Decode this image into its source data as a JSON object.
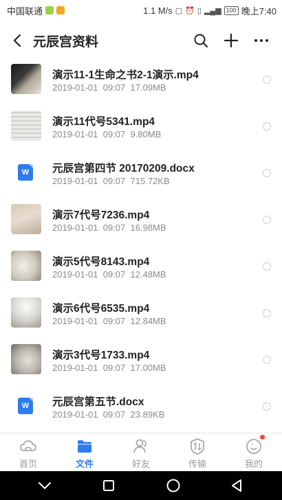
{
  "status_bar": {
    "carrier": "中国联通",
    "speed": "1.1 M/s",
    "battery": "100",
    "time": "晚上7:40"
  },
  "header": {
    "title": "元辰宫资料"
  },
  "files": [
    {
      "name": "演示11-1生命之书2-1演示.mp4",
      "date": "2019-01-01",
      "time": "09:07",
      "size": "17.09MB",
      "kind": "video"
    },
    {
      "name": "演示11代号5341.mp4",
      "date": "2019-01-01",
      "time": "09:07",
      "size": "9.80MB",
      "kind": "video"
    },
    {
      "name": "元辰宫第四节 20170209.docx",
      "date": "2019-01-01",
      "time": "09:07",
      "size": "715.72KB",
      "kind": "doc"
    },
    {
      "name": "演示7代号7236.mp4",
      "date": "2019-01-01",
      "time": "09:07",
      "size": "16.98MB",
      "kind": "video"
    },
    {
      "name": "演示5代号8143.mp4",
      "date": "2019-01-01",
      "time": "09:07",
      "size": "12.48MB",
      "kind": "video"
    },
    {
      "name": "演示6代号6535.mp4",
      "date": "2019-01-01",
      "time": "09:07",
      "size": "12.84MB",
      "kind": "video"
    },
    {
      "name": "演示3代号1733.mp4",
      "date": "2019-01-01",
      "time": "09:07",
      "size": "17.00MB",
      "kind": "video"
    },
    {
      "name": "元辰宫第五节.docx",
      "date": "2019-01-01",
      "time": "09:07",
      "size": "23.89KB",
      "kind": "doc"
    }
  ],
  "doc_icon_letter": "W",
  "tabs": [
    {
      "label": "首页",
      "icon": "cloud-home-icon"
    },
    {
      "label": "文件",
      "icon": "folder-icon"
    },
    {
      "label": "好友",
      "icon": "friends-icon"
    },
    {
      "label": "传输",
      "icon": "transfer-icon"
    },
    {
      "label": "我的",
      "icon": "profile-icon"
    }
  ],
  "colors": {
    "accent": "#2f7bf0",
    "badge": "#f0443a"
  }
}
